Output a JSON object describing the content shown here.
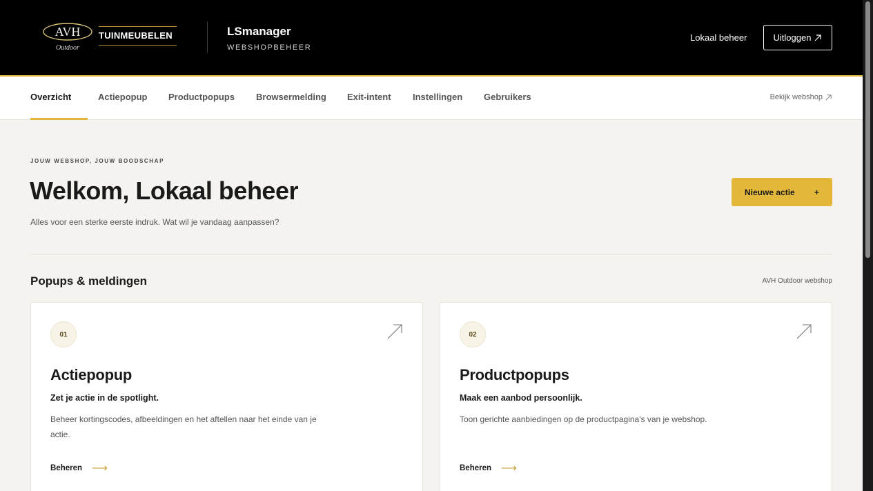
{
  "header": {
    "logo_text": "AVH",
    "logo_sub": "Outdoor",
    "brand": "TUINMEUBELEN",
    "app_title": "LSmanager",
    "app_subtitle": "WEBSHOPBEHEER",
    "user": "Lokaal beheer",
    "logout_label": "Uitloggen",
    "logout_icon": "external-arrow-icon"
  },
  "nav": {
    "tabs": [
      {
        "label": "Overzicht",
        "active": true
      },
      {
        "label": "Actiepopup"
      },
      {
        "label": "Productpopups"
      },
      {
        "label": "Browsermelding"
      },
      {
        "label": "Exit-intent"
      },
      {
        "label": "Instellingen"
      },
      {
        "label": "Gebruikers"
      }
    ],
    "external_link": "Bekijk webshop"
  },
  "hero": {
    "eyebrow": "JOUW WEBSHOP, JOUW BOODSCHAP",
    "title": "Welkom, Lokaal beheer",
    "subtitle": "Alles voor een sterke eerste indruk. Wat wil je vandaag aanpassen?",
    "new_action_label": "Nieuwe actie",
    "new_action_icon": "+"
  },
  "section": {
    "title": "Popups & meldingen",
    "meta": "AVH Outdoor webshop",
    "cards": [
      {
        "number": "01",
        "title": "Actiepopup",
        "tagline": "Zet je actie in de spotlight.",
        "description": "Beheer kortingscodes, afbeeldingen en het aftellen naar het einde van je actie.",
        "link": "Beheren"
      },
      {
        "number": "02",
        "title": "Productpopups",
        "tagline": "Maak een aanbod persoonlijk.",
        "description": "Toon gerichte aanbiedingen op de productpagina's van je webshop.",
        "link": "Beheren"
      }
    ]
  },
  "colors": {
    "accent": "#e2b73a",
    "header_bg": "#000000",
    "page_bg": "#f4f3ef"
  }
}
